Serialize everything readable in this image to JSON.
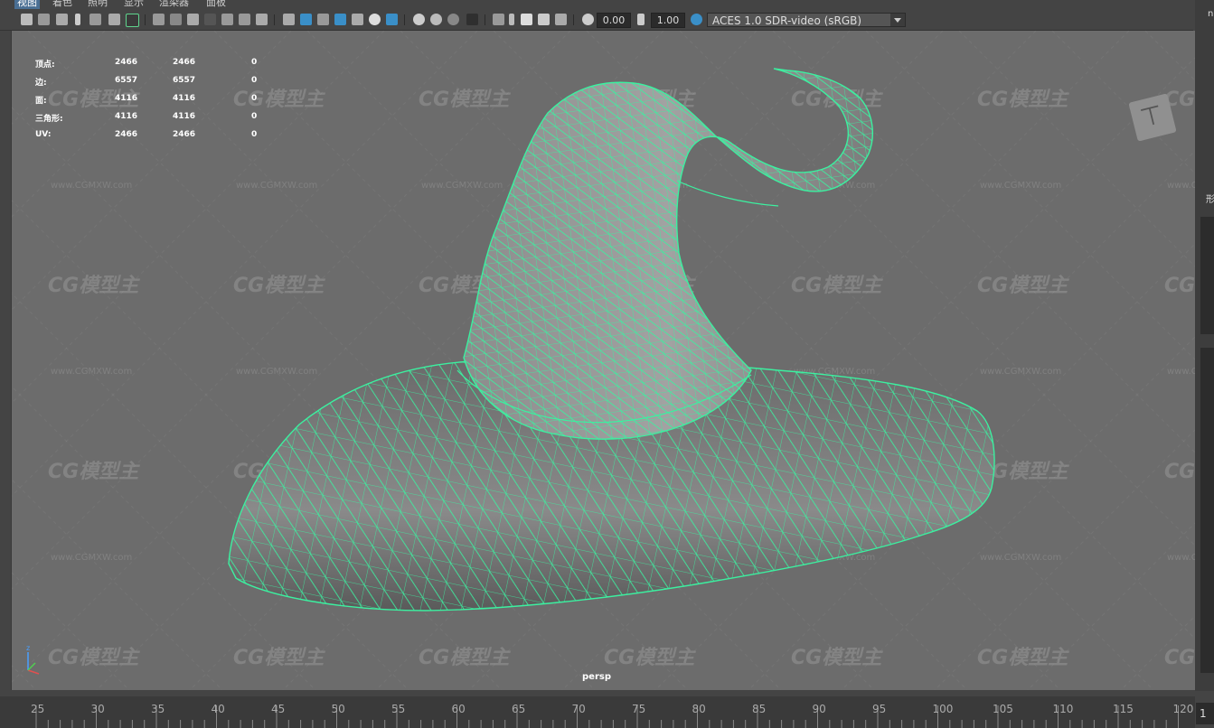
{
  "menubar": {
    "items": [
      {
        "label": "视图",
        "active": true
      },
      {
        "label": "着色"
      },
      {
        "label": "照明"
      },
      {
        "label": "显示"
      },
      {
        "label": "渲染器"
      },
      {
        "label": "面板"
      }
    ]
  },
  "toolbar": {
    "exposure_value": "0.00",
    "gamma_value": "1.00",
    "color_space": "ACES 1.0 SDR-video (sRGB)",
    "icons": [
      "camera-icon",
      "camera-attr-icon",
      "bookmark-icon",
      "image-plane-icon",
      "grid-toggle-icon",
      "grease-pencil-icon",
      "film-gate-icon",
      "resolution-gate-icon",
      "gate-mask-icon",
      "field-chart-icon",
      "safe-action-icon",
      "safe-title-icon",
      "wireframe-icon",
      "smooth-shade-icon",
      "wireframe-on-shaded-icon",
      "xray-icon",
      "textured-icon",
      "lights-icon",
      "shadows-icon",
      "ambient-occlusion-icon",
      "motion-blur-icon",
      "anti-alias-icon",
      "isolate-select-icon",
      "xray-joints-icon",
      "xray-active-icon",
      "backface-icon",
      "exposure-icon",
      "gamma-icon",
      "color-management-icon"
    ]
  },
  "hud": {
    "rows": [
      {
        "label": "顶点:",
        "a": "2466",
        "b": "2466",
        "c": "0"
      },
      {
        "label": "边:",
        "a": "6557",
        "b": "6557",
        "c": "0"
      },
      {
        "label": "面:",
        "a": "4116",
        "b": "4116",
        "c": "0"
      },
      {
        "label": "三角形:",
        "a": "4116",
        "b": "4116",
        "c": "0"
      },
      {
        "label": "UV:",
        "a": "2466",
        "b": "2466",
        "c": "0"
      }
    ]
  },
  "viewport": {
    "camera_label": "persp",
    "axis_label": "z",
    "watermark_logo": "CG模型主",
    "watermark_url": "www.CGMXW.com",
    "wire_color": "#3cf0a0",
    "background_color": "#6c6c6c"
  },
  "timeline": {
    "ticks": [
      "25",
      "30",
      "35",
      "40",
      "45",
      "50",
      "55",
      "60",
      "65",
      "70",
      "75",
      "80",
      "85",
      "90",
      "95",
      "100",
      "105",
      "110",
      "115",
      "120"
    ],
    "current_frame": "1"
  },
  "right_panel": {
    "fragments": [
      "n",
      "形"
    ]
  }
}
